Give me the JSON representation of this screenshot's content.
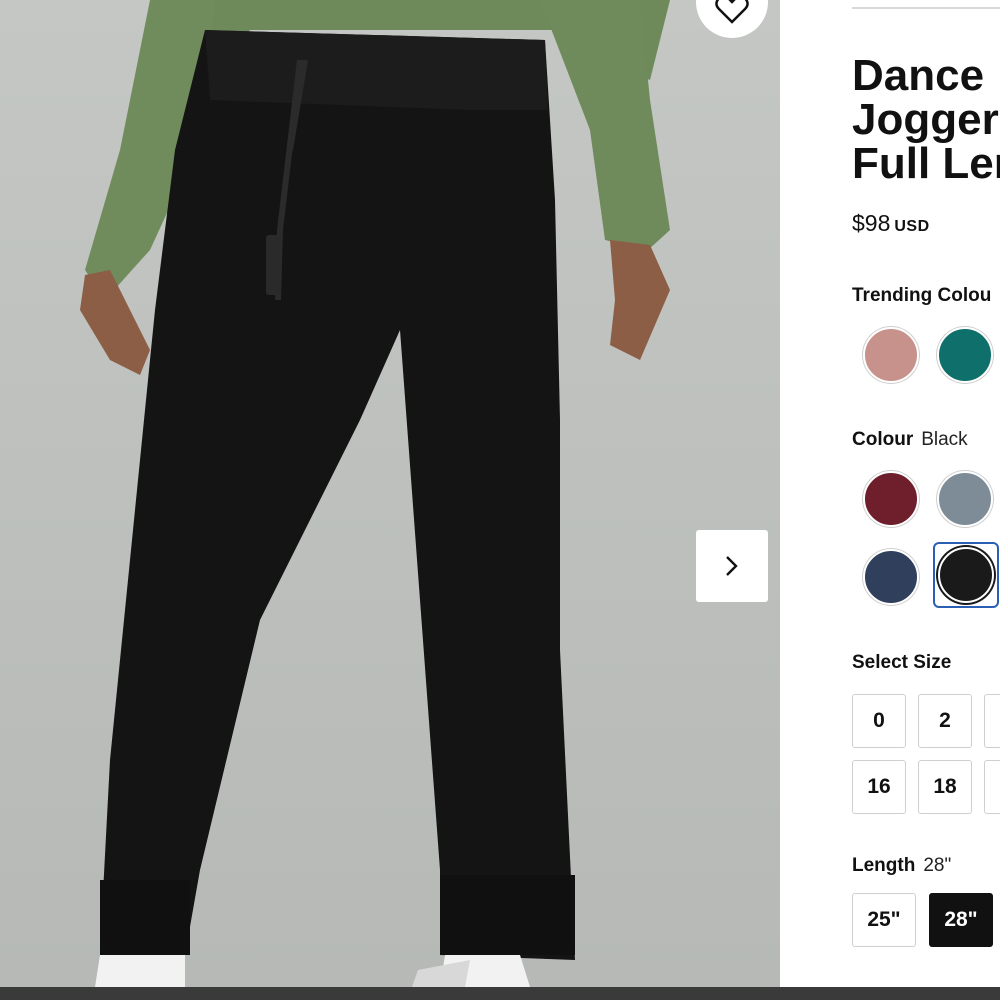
{
  "product": {
    "title_lines": [
      "Dance",
      "Jogger",
      "Full Len"
    ],
    "price": "$98",
    "currency": "USD"
  },
  "trending_colours": {
    "label": "Trending Colou",
    "swatches": [
      {
        "name": "rose",
        "color": "#c8928c"
      },
      {
        "name": "teal",
        "color": "#0e6f6b"
      }
    ]
  },
  "colour": {
    "label": "Colour",
    "selected": "Black",
    "swatches": [
      {
        "name": "burgundy",
        "color": "#6e1f2b"
      },
      {
        "name": "heathered-grey",
        "color": "#7e8c98"
      },
      {
        "name": "navy",
        "color": "#2f3f5c"
      },
      {
        "name": "black",
        "color": "#1a1a1a"
      }
    ]
  },
  "size": {
    "label": "Select Size",
    "options": [
      "0",
      "2",
      "16",
      "18"
    ]
  },
  "length": {
    "label": "Length",
    "selected": "28\"",
    "options": [
      "25\"",
      "28\""
    ]
  },
  "icons": {
    "wishlist": "heart-icon",
    "next": "chevron-right-icon"
  },
  "colors": {
    "gallery_background": "#c6c9c6",
    "selection_outline": "#2b5fb3"
  }
}
